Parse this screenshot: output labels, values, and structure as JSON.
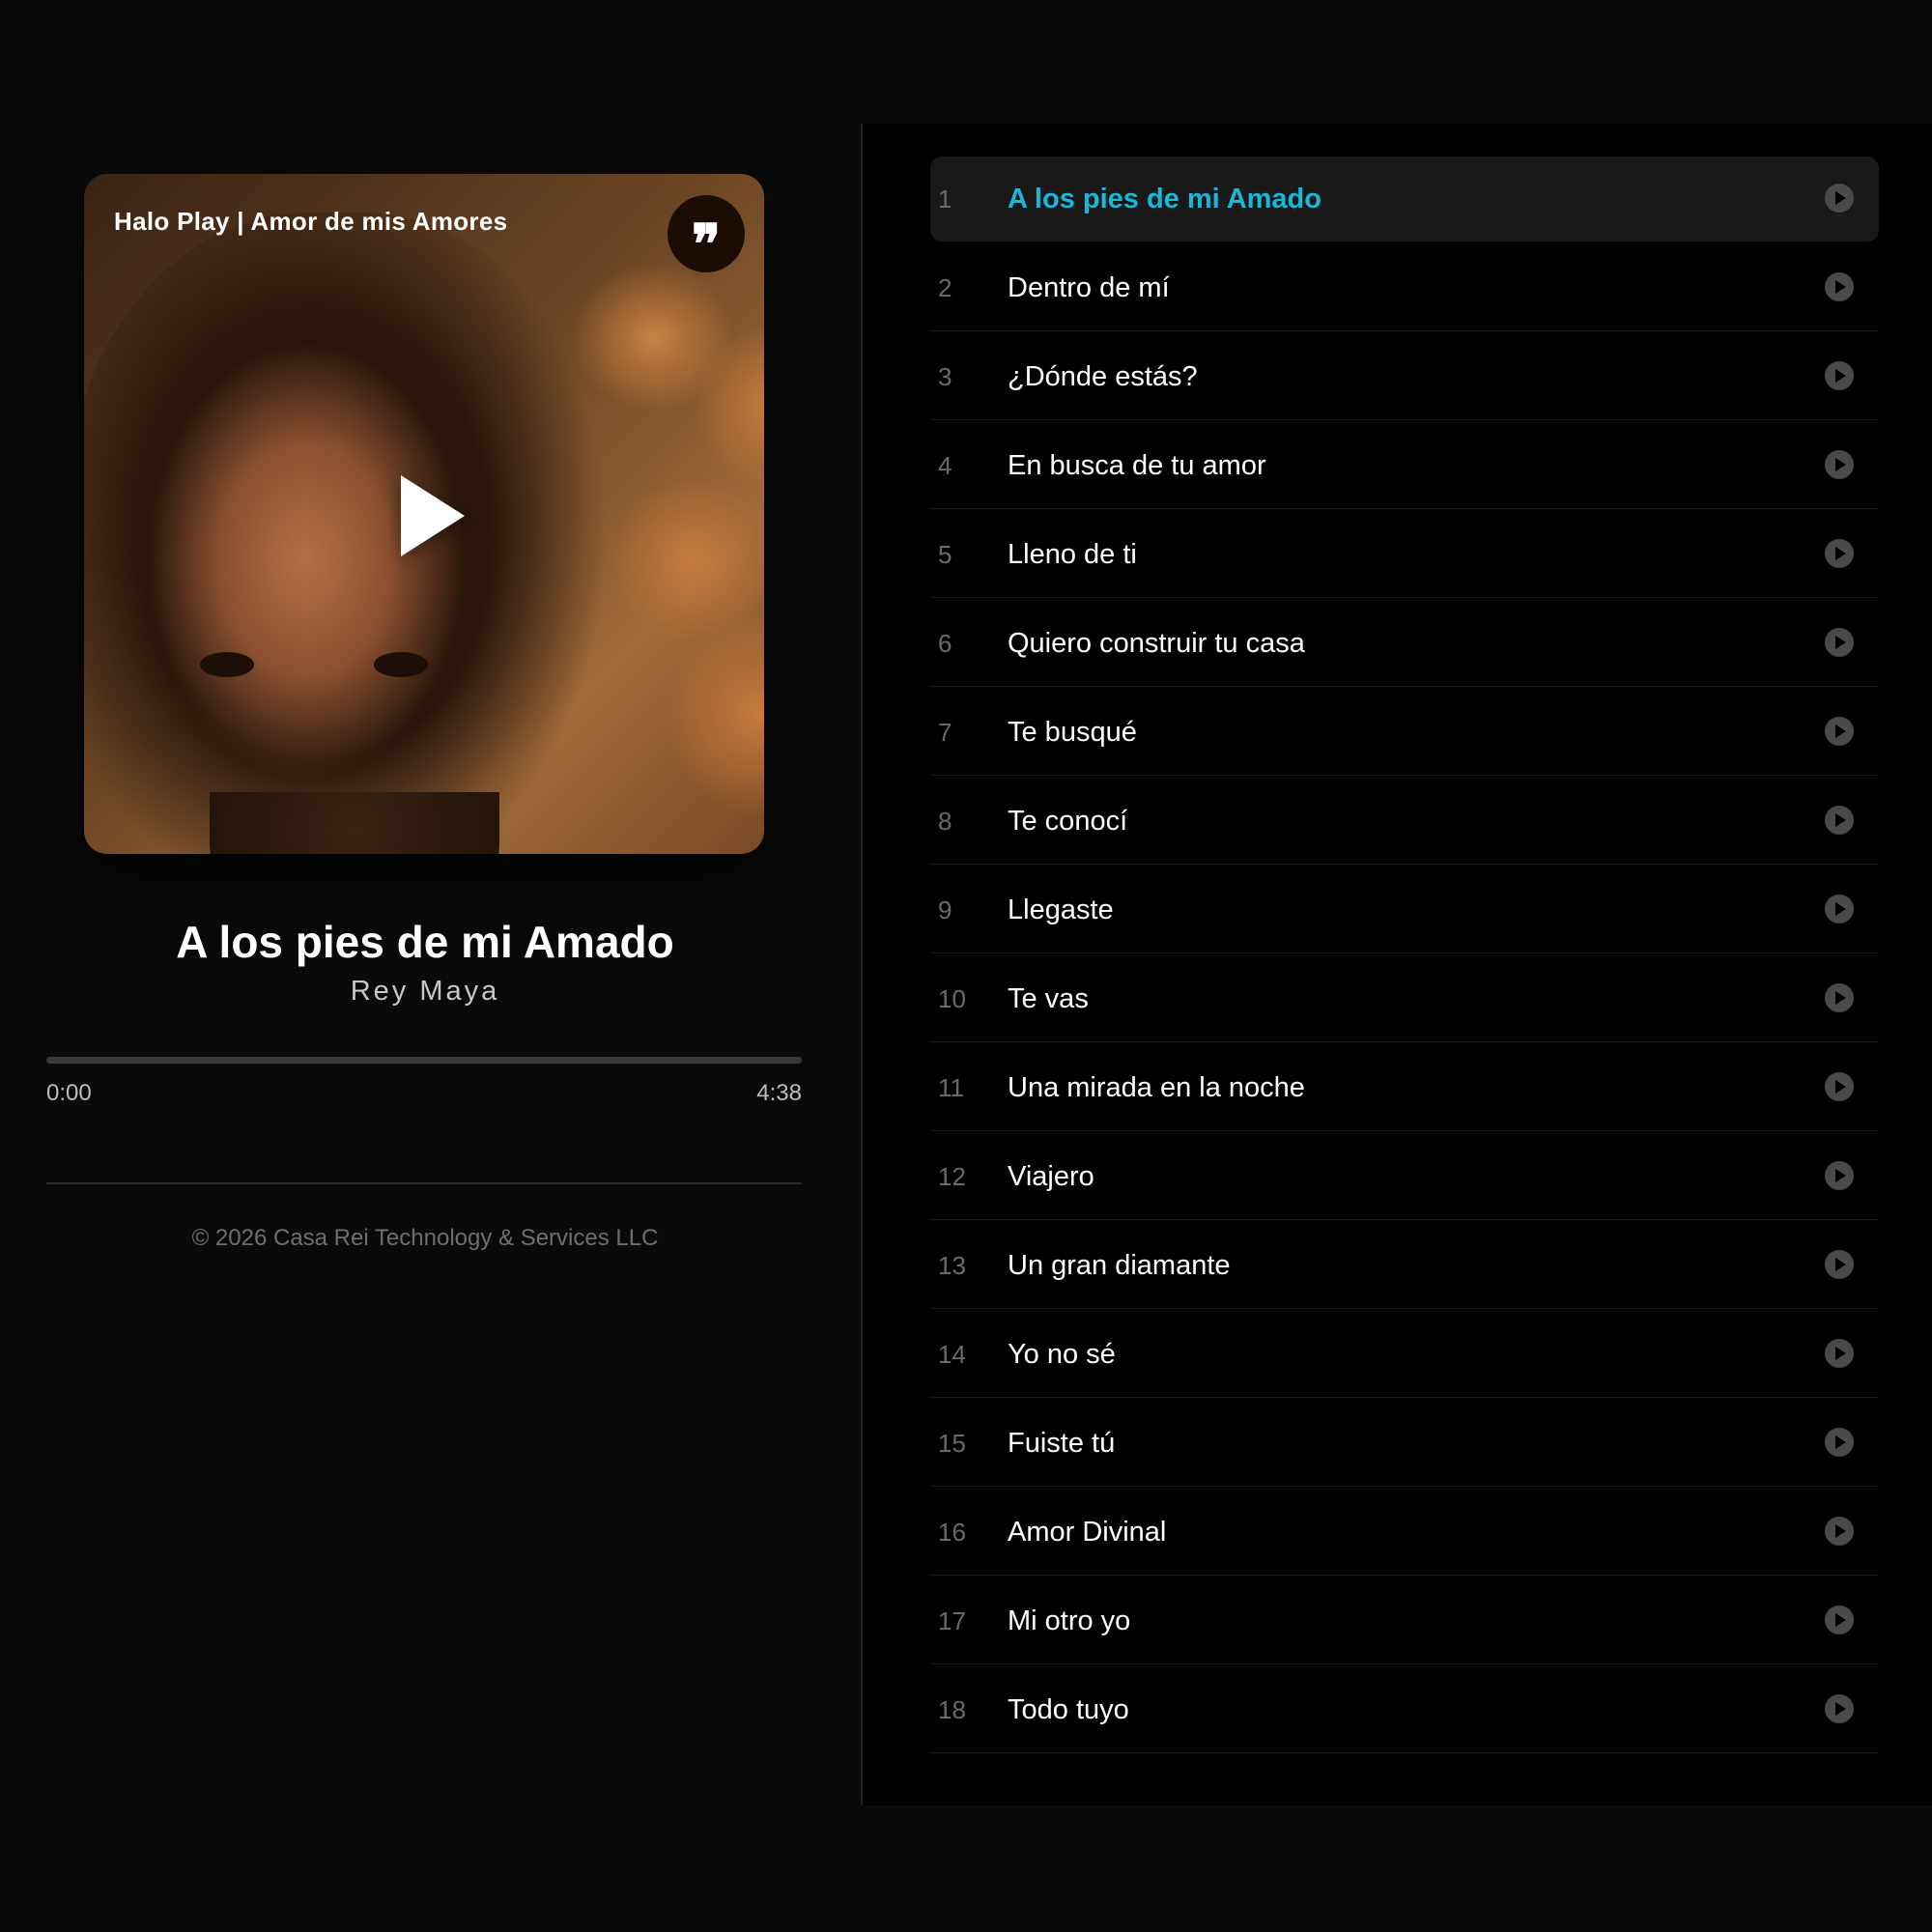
{
  "player": {
    "cover_title": "Halo Play | Amor de mis Amores",
    "lyrics_icon": "quote-icon",
    "lyrics_glyph": "❞",
    "now_playing_title": "A los pies de mi Amado",
    "artist": "Rey Maya",
    "progress_fraction": 0,
    "time_current": "0:00",
    "time_total": "4:38",
    "footer": "© 2026 Casa Rei Technology & Services LLC"
  },
  "playlist": {
    "active_index": 0,
    "accent_color": "#19b8d8",
    "tracks": [
      {
        "num": "1",
        "title": "A los pies de mi Amado"
      },
      {
        "num": "2",
        "title": "Dentro de mí"
      },
      {
        "num": "3",
        "title": "¿Dónde estás?"
      },
      {
        "num": "4",
        "title": "En busca de tu amor"
      },
      {
        "num": "5",
        "title": "Lleno de ti"
      },
      {
        "num": "6",
        "title": "Quiero construir tu casa"
      },
      {
        "num": "7",
        "title": "Te busqué"
      },
      {
        "num": "8",
        "title": "Te conocí"
      },
      {
        "num": "9",
        "title": "Llegaste"
      },
      {
        "num": "10",
        "title": "Te vas"
      },
      {
        "num": "11",
        "title": "Una mirada en la noche"
      },
      {
        "num": "12",
        "title": "Viajero"
      },
      {
        "num": "13",
        "title": "Un gran diamante"
      },
      {
        "num": "14",
        "title": "Yo no sé"
      },
      {
        "num": "15",
        "title": "Fuiste tú"
      },
      {
        "num": "16",
        "title": "Amor Divinal"
      },
      {
        "num": "17",
        "title": "Mi otro yo"
      },
      {
        "num": "18",
        "title": "Todo tuyo"
      }
    ]
  }
}
